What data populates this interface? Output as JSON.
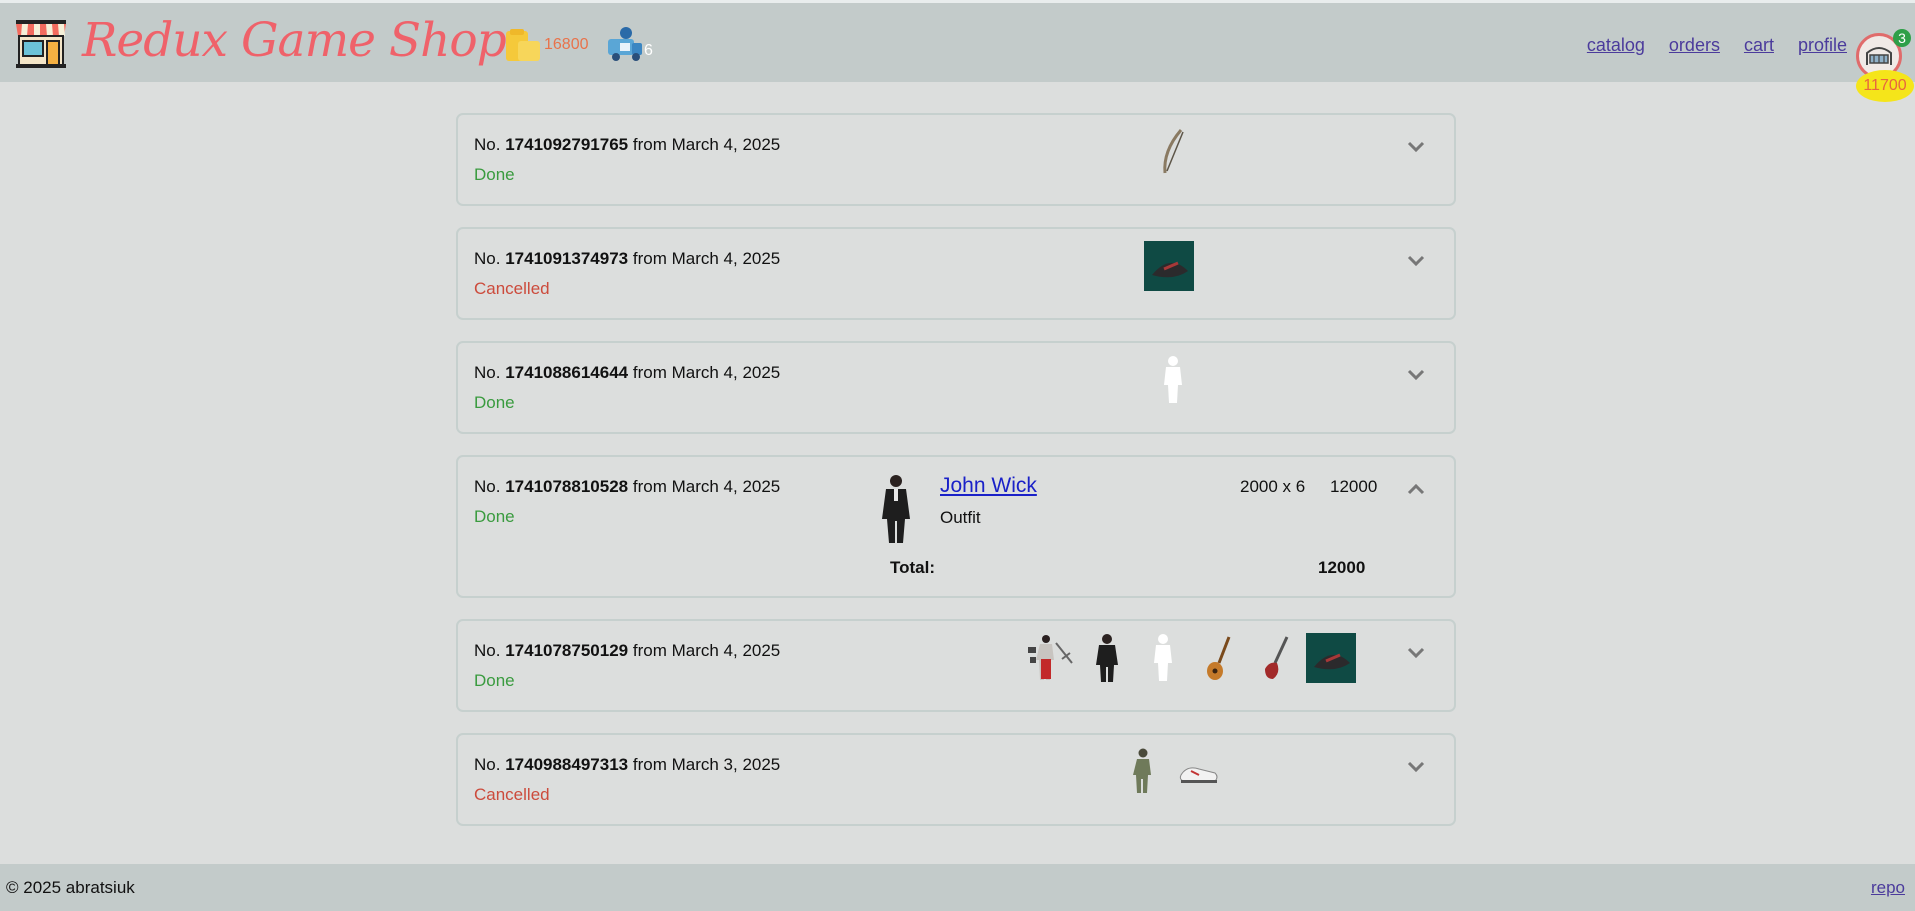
{
  "header": {
    "brand": "Redux Game Shop",
    "coins": "16800",
    "orders_count": "6",
    "nav": [
      "catalog",
      "orders",
      "cart",
      "profile"
    ],
    "cart_count": "3",
    "balance": "11700"
  },
  "orders": [
    {
      "no_label": "No.",
      "id": "1741092791765",
      "date": "from March 4, 2025",
      "status": "Done"
    },
    {
      "no_label": "No.",
      "id": "1741091374973",
      "date": "from March 4, 2025",
      "status": "Cancelled"
    },
    {
      "no_label": "No.",
      "id": "1741088614644",
      "date": "from March 4, 2025",
      "status": "Done"
    },
    {
      "no_label": "No.",
      "id": "1741078810528",
      "date": "from March 4, 2025",
      "status": "Done",
      "item": {
        "name": "John Wick",
        "type": "Outfit",
        "qty": "2000 x 6",
        "sum": "12000"
      },
      "total_label": "Total:",
      "total": "12000"
    },
    {
      "no_label": "No.",
      "id": "1741078750129",
      "date": "from March 4, 2025",
      "status": "Done"
    },
    {
      "no_label": "No.",
      "id": "1740988497313",
      "date": "from March 3, 2025",
      "status": "Cancelled"
    }
  ],
  "footer": {
    "copyright": "© 2025 abratsiuk",
    "repo": "repo"
  },
  "colors": {
    "done": "#3a9b3f",
    "cancelled": "#cc4b3c",
    "link": "#4b3b9c",
    "brand": "#ef626a"
  },
  "icons": [
    "shop-icon",
    "coins-icon",
    "delivery-icon",
    "cart-icon",
    "chevron-down-icon",
    "chevron-up-icon"
  ]
}
